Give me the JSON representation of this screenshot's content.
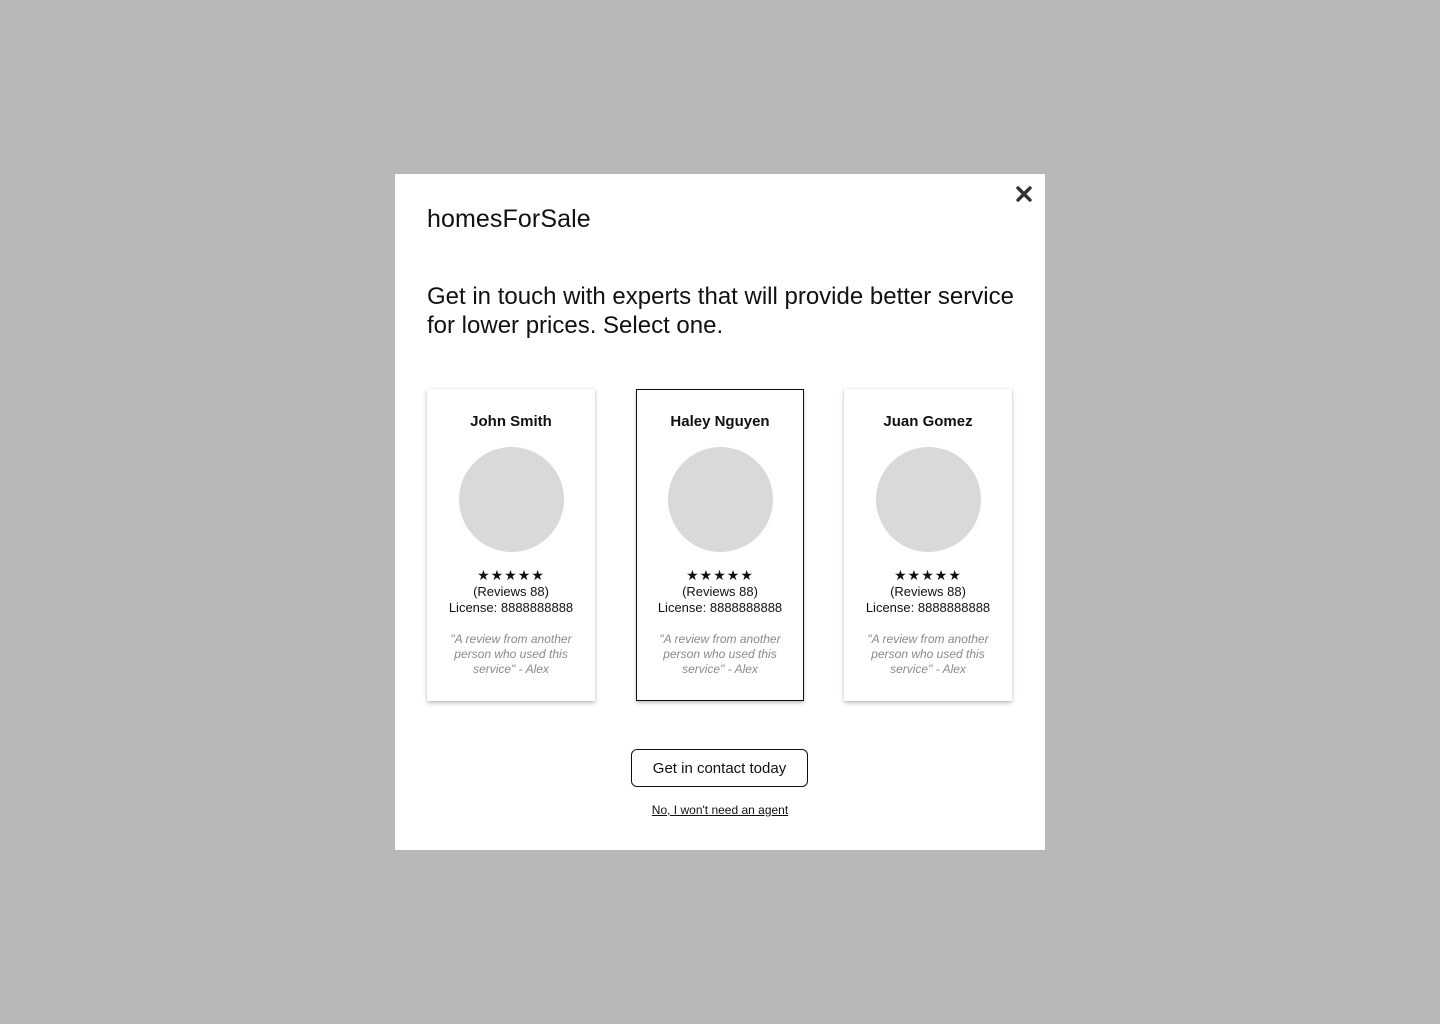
{
  "modal": {
    "brand": "homesForSale",
    "headline": "Get in touch with experts that will provide better service for lower prices. Select one.",
    "close_icon": "close-icon",
    "agents": [
      {
        "name": "John Smith",
        "rating": "★★★★★",
        "rating_value": 5,
        "reviews": "(Reviews 88)",
        "license": "License: 8888888888",
        "quote": "\"A review from another person who used this service\" - Alex",
        "selected": false
      },
      {
        "name": "Haley Nguyen",
        "rating": "★★★★★",
        "rating_value": 5,
        "reviews": "(Reviews 88)",
        "license": "License: 8888888888",
        "quote": "\"A review from another person who used this service\" - Alex",
        "selected": true
      },
      {
        "name": "Juan Gomez",
        "rating": "★★★★★",
        "rating_value": 5,
        "reviews": "(Reviews 88)",
        "license": "License: 8888888888",
        "quote": "\"A review from another person who used this service\" - Alex",
        "selected": false
      }
    ],
    "cta_label": "Get in contact today",
    "decline_label": "No, I won't need an agent"
  },
  "colors": {
    "backdrop": "#b8b8b8",
    "modal_bg": "#ffffff",
    "avatar_placeholder": "#d9d9d9",
    "quote_text": "#8a8a8a"
  }
}
